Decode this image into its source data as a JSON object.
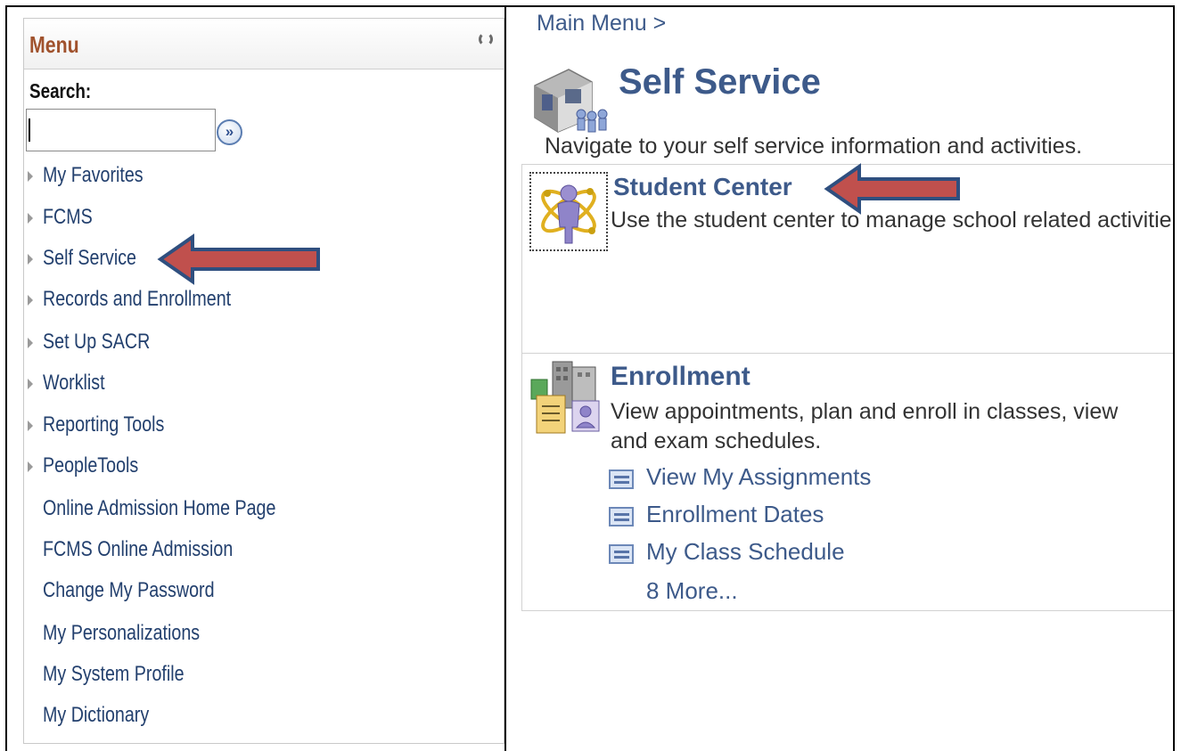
{
  "menu": {
    "title": "Menu",
    "search_label": "Search:",
    "search_value": "",
    "search_go": "»",
    "items": [
      {
        "label": "My Favorites",
        "folder": true
      },
      {
        "label": "FCMS",
        "folder": true
      },
      {
        "label": "Self Service",
        "folder": true
      },
      {
        "label": "Records and Enrollment",
        "folder": true
      },
      {
        "label": "Set Up SACR",
        "folder": true
      },
      {
        "label": "Worklist",
        "folder": true
      },
      {
        "label": "Reporting Tools",
        "folder": true
      },
      {
        "label": "PeopleTools",
        "folder": true
      },
      {
        "label": "Online Admission Home Page",
        "folder": false
      },
      {
        "label": "FCMS Online Admission",
        "folder": false
      },
      {
        "label": "Change My Password",
        "folder": false
      },
      {
        "label": "My Personalizations",
        "folder": false
      },
      {
        "label": "My System Profile",
        "folder": false
      },
      {
        "label": "My Dictionary",
        "folder": false
      }
    ]
  },
  "content": {
    "breadcrumb": "Main Menu >",
    "page_title": "Self Service",
    "page_desc": "Navigate to your self service information and activities.",
    "student_center": {
      "title": "Student Center",
      "desc": "Use the student center to manage school related activities."
    },
    "enrollment": {
      "title": "Enrollment",
      "desc_line1": "View appointments, plan and enroll in classes, view",
      "desc_line2": "and exam schedules.",
      "links": [
        "View My Assignments",
        "Enrollment Dates",
        "My Class Schedule"
      ],
      "more": "8 More..."
    }
  },
  "colors": {
    "menu_title": "#a0522d",
    "link": "#23406e",
    "heading": "#3d5a8a",
    "arrow_fill": "#c0504d",
    "arrow_stroke": "#2f4f7f"
  }
}
